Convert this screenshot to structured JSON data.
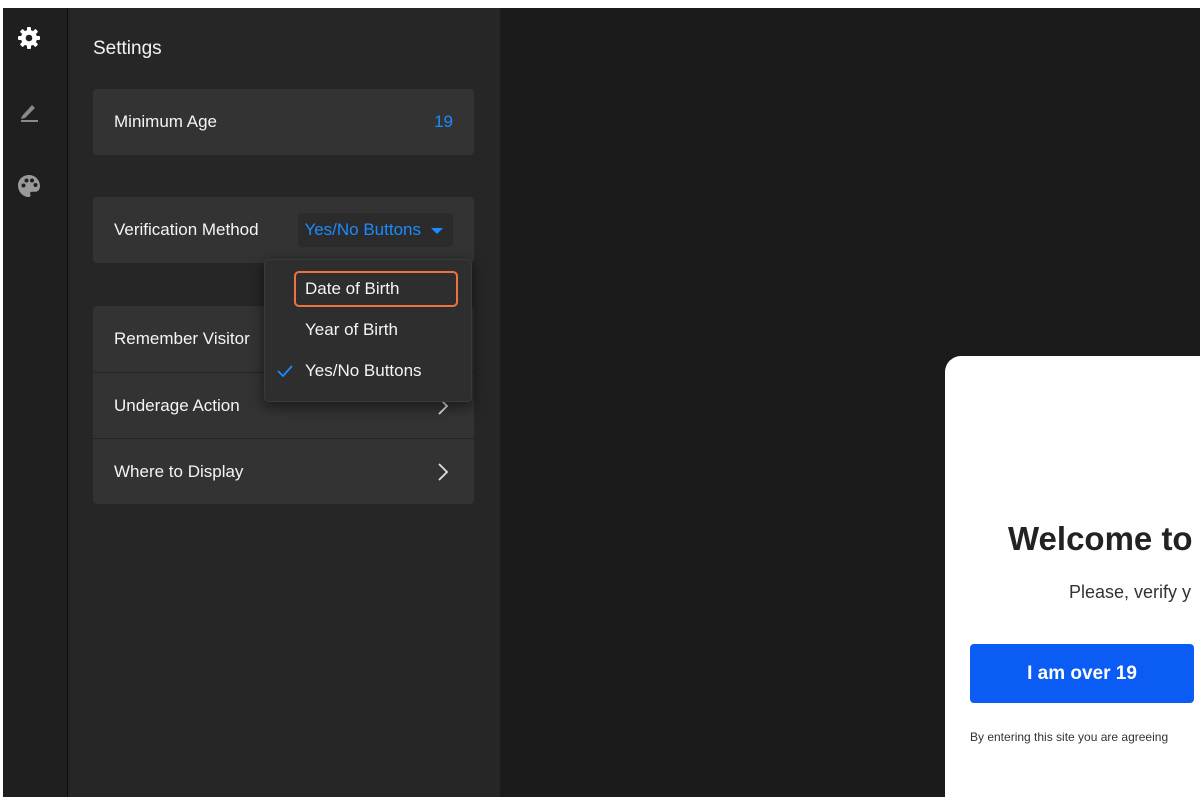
{
  "sidebar": {
    "icons": [
      "gear-icon",
      "pen-icon",
      "palette-icon"
    ]
  },
  "settings": {
    "title": "Settings",
    "minimum_age": {
      "label": "Minimum Age",
      "value": "19"
    },
    "verification_method": {
      "label": "Verification Method",
      "selected": "Yes/No Buttons"
    },
    "rows": [
      {
        "label": "Remember Visitor"
      },
      {
        "label": "Underage Action"
      },
      {
        "label": "Where to Display"
      }
    ]
  },
  "dropdown": {
    "options": [
      {
        "label": "Date of Birth",
        "highlighted": true,
        "checked": false
      },
      {
        "label": "Year of Birth",
        "highlighted": false,
        "checked": false
      },
      {
        "label": "Yes/No Buttons",
        "highlighted": false,
        "checked": true
      }
    ]
  },
  "preview": {
    "welcome": "Welcome to",
    "verify_text": "Please, verify y",
    "button_label": "I am over 19",
    "terms": "By entering this site you are agreeing"
  },
  "colors": {
    "accent": "#1a8cff",
    "highlight_border": "#f0733e",
    "cta": "#0a5cf5"
  }
}
